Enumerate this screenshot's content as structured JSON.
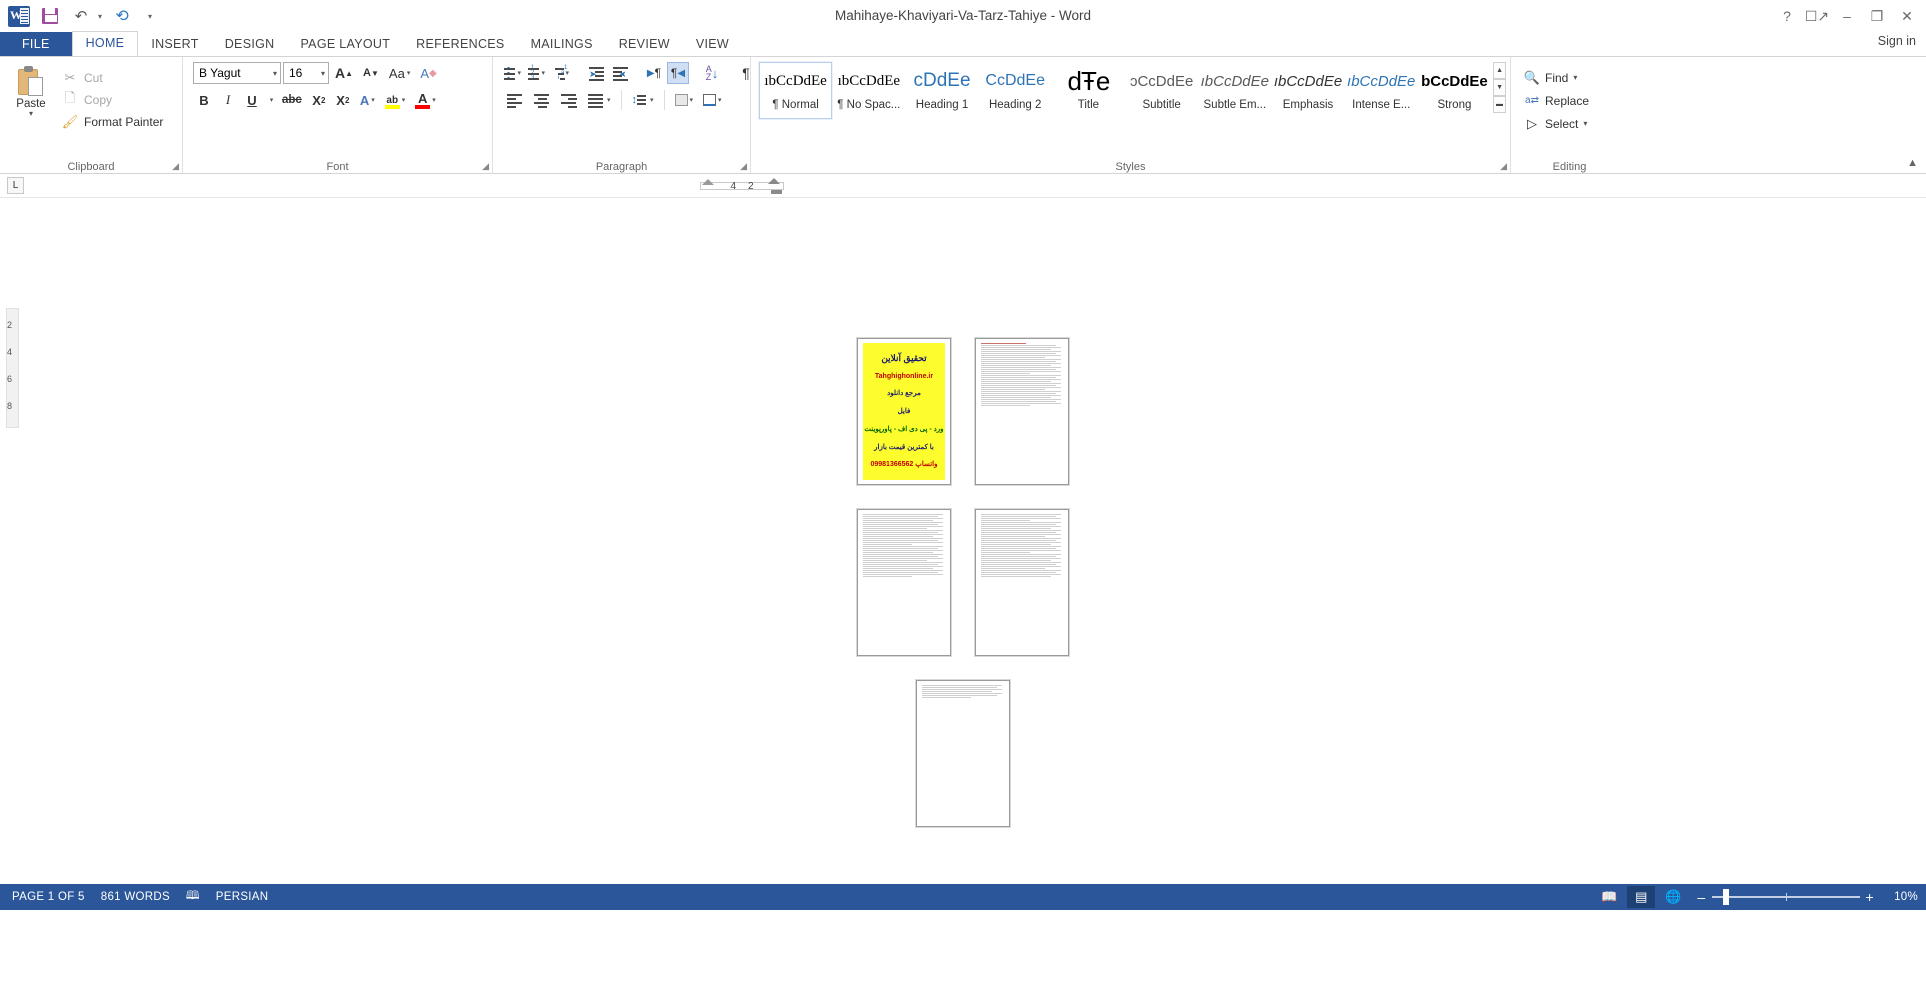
{
  "window": {
    "title": "Mahihaye-Khaviyari-Va-Tarz-Tahiye - Word",
    "sign_in": "Sign in",
    "help_icon": "?",
    "ribbon_display_icon": "ribbon-display-options",
    "minimize_icon": "–",
    "restore_icon": "❐",
    "close_icon": "✕"
  },
  "quick_access": {
    "app_logo": "word-logo",
    "save_label": "Save",
    "undo_label": "Undo",
    "redo_label": "Repeat",
    "customize_label": "Customize Quick Access Toolbar"
  },
  "tabs": [
    {
      "label": "FILE",
      "state": "file"
    },
    {
      "label": "HOME",
      "state": "active"
    },
    {
      "label": "INSERT",
      "state": ""
    },
    {
      "label": "DESIGN",
      "state": ""
    },
    {
      "label": "PAGE LAYOUT",
      "state": ""
    },
    {
      "label": "REFERENCES",
      "state": ""
    },
    {
      "label": "MAILINGS",
      "state": ""
    },
    {
      "label": "REVIEW",
      "state": ""
    },
    {
      "label": "VIEW",
      "state": ""
    }
  ],
  "clipboard": {
    "group_label": "Clipboard",
    "paste_label": "Paste",
    "cut_label": "Cut",
    "copy_label": "Copy",
    "format_painter_label": "Format Painter"
  },
  "font": {
    "group_label": "Font",
    "name_value": "B Yagut",
    "size_value": "16",
    "grow_label": "A",
    "shrink_label": "A",
    "change_case_label": "Aa",
    "clear_format_label": "A",
    "bold_label": "B",
    "italic_label": "I",
    "underline_label": "U",
    "strikethrough_label": "abc",
    "subscript_label": "X",
    "superscript_label": "X",
    "text_effects_label": "A",
    "highlight_label": "ab",
    "font_color_label": "A",
    "highlight_color": "#ffff00",
    "font_color": "#ff0000"
  },
  "paragraph": {
    "group_label": "Paragraph",
    "bullets_label": "Bullets",
    "numbering_label": "Numbering",
    "multilevel_label": "Multilevel List",
    "decrease_indent_label": "Decrease Indent",
    "increase_indent_label": "Increase Indent",
    "ltr_label": "Left-to-Right Text Direction",
    "rtl_label": "Right-to-Left Text Direction",
    "sort_label": "Sort",
    "show_marks_label": "¶",
    "align_left_label": "Align Left",
    "align_center_label": "Center",
    "align_right_label": "Align Right",
    "justify_label": "Justify",
    "line_spacing_label": "Line and Paragraph Spacing",
    "shading_label": "Shading",
    "borders_label": "Borders"
  },
  "styles": {
    "group_label": "Styles",
    "items": [
      {
        "preview": "ıbCcDdEe",
        "name": "¶ Normal",
        "kind": "normal",
        "selected": true
      },
      {
        "preview": "ıbCcDdEe",
        "name": "¶ No Spac...",
        "kind": "normal",
        "selected": false
      },
      {
        "preview": "cDdEe",
        "name": "Heading 1",
        "kind": "blue",
        "selected": false
      },
      {
        "preview": "CcDdEe",
        "name": "Heading 2",
        "kind": "blue",
        "selected": false
      },
      {
        "preview": "dŦe",
        "name": "Title",
        "kind": "title",
        "selected": false
      },
      {
        "preview": "ɔCcDdEe",
        "name": "Subtitle",
        "kind": "gray",
        "selected": false
      },
      {
        "preview": "ıbCcDdEe",
        "name": "Subtle Em...",
        "kind": "ital",
        "selected": false
      },
      {
        "preview": "ıbCcDdEe",
        "name": "Emphasis",
        "kind": "ital",
        "selected": false
      },
      {
        "preview": "ıbCcDdEe",
        "name": "Intense E...",
        "kind": "intense",
        "selected": false
      },
      {
        "preview": "bCcDdEe",
        "name": "Strong",
        "kind": "bold",
        "selected": false
      }
    ],
    "scroll_up": "▲",
    "scroll_down": "▼",
    "more": "▬"
  },
  "editing": {
    "group_label": "Editing",
    "find_label": "Find",
    "replace_label": "Replace",
    "select_label": "Select"
  },
  "ribbon": {
    "collapse_label": "▲"
  },
  "ruler": {
    "tab_stop_label": "L",
    "numbers": [
      "4",
      "2"
    ]
  },
  "vertical_ruler": {
    "numbers": [
      "2",
      "4",
      "6",
      "8"
    ]
  },
  "document": {
    "zoom_percent": "10%",
    "page_rows": [
      {
        "pages": [
          {
            "type": "ad",
            "lines": [
              {
                "text": "تحقیق آنلاین",
                "style": "big dark"
              },
              {
                "text": "Tahghighonline.ir",
                "style": ""
              },
              {
                "text": "مرجع دانلود",
                "style": "dark"
              },
              {
                "text": "فایل",
                "style": "dark"
              },
              {
                "text": "ورد - پی دی اف - پاورپوینت",
                "style": "grn"
              },
              {
                "text": "با کمترین قیمت بازار",
                "style": "dark"
              },
              {
                "text": "09981366562 واتساپ",
                "style": ""
              }
            ]
          },
          {
            "type": "text",
            "line_count": 34,
            "has_red_heading": true
          }
        ]
      },
      {
        "pages": [
          {
            "type": "text",
            "line_count": 34,
            "has_red_heading": false
          },
          {
            "type": "text",
            "line_count": 34,
            "has_red_heading": false
          }
        ]
      },
      {
        "pages": [
          {
            "type": "text_short",
            "line_count": 7,
            "has_red_heading": false
          }
        ]
      }
    ]
  },
  "statusbar": {
    "page_label": "PAGE 1 OF 5",
    "words_label": "861 WORDS",
    "proofing_icon": "proofing-errors-icon",
    "language_label": "PERSIAN",
    "views": [
      {
        "icon": "read-mode-icon",
        "label": "Read Mode",
        "active": false
      },
      {
        "icon": "print-layout-icon",
        "label": "Print Layout",
        "active": true
      },
      {
        "icon": "web-layout-icon",
        "label": "Web Layout",
        "active": false
      }
    ],
    "zoom_out": "–",
    "zoom_in": "+",
    "zoom_value": "10%"
  },
  "colors": {
    "brand_blue": "#2b579a",
    "accent_light": "#cfe0f5",
    "style_blue": "#2e74b5",
    "highlight_yellow": "#ffff00"
  }
}
